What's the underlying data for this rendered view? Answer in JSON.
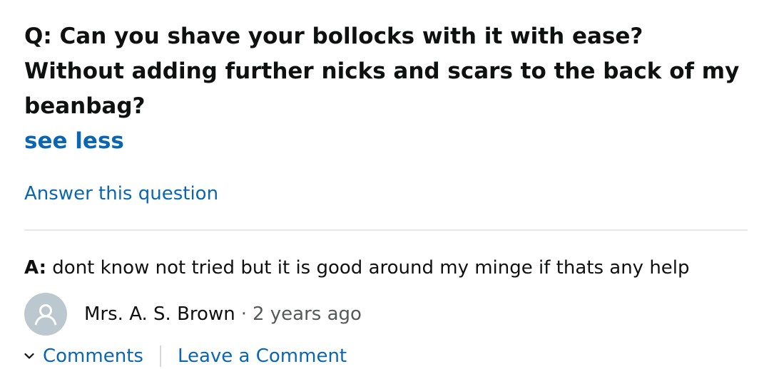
{
  "question": {
    "text": "Q: Can you shave your bollocks with it with ease? Without adding further nicks and scars to the back of my beanbag?",
    "see_less_label": "see less",
    "answer_link_label": "Answer this question"
  },
  "answer": {
    "prefix": "A:",
    "text": " dont know not tried but it is good around my minge if thats any help",
    "author": "Mrs. A. S. Brown",
    "separator": "·",
    "time": "2 years ago"
  },
  "actions": {
    "comments_label": "Comments",
    "leave_comment_label": "Leave a Comment",
    "chevron_icon": "chevron-down-icon"
  },
  "colors": {
    "link": "#0a66b2",
    "text": "#0f1111",
    "muted": "#565959",
    "avatar_bg": "#bcc8cf",
    "divider": "#e7e7e7"
  }
}
